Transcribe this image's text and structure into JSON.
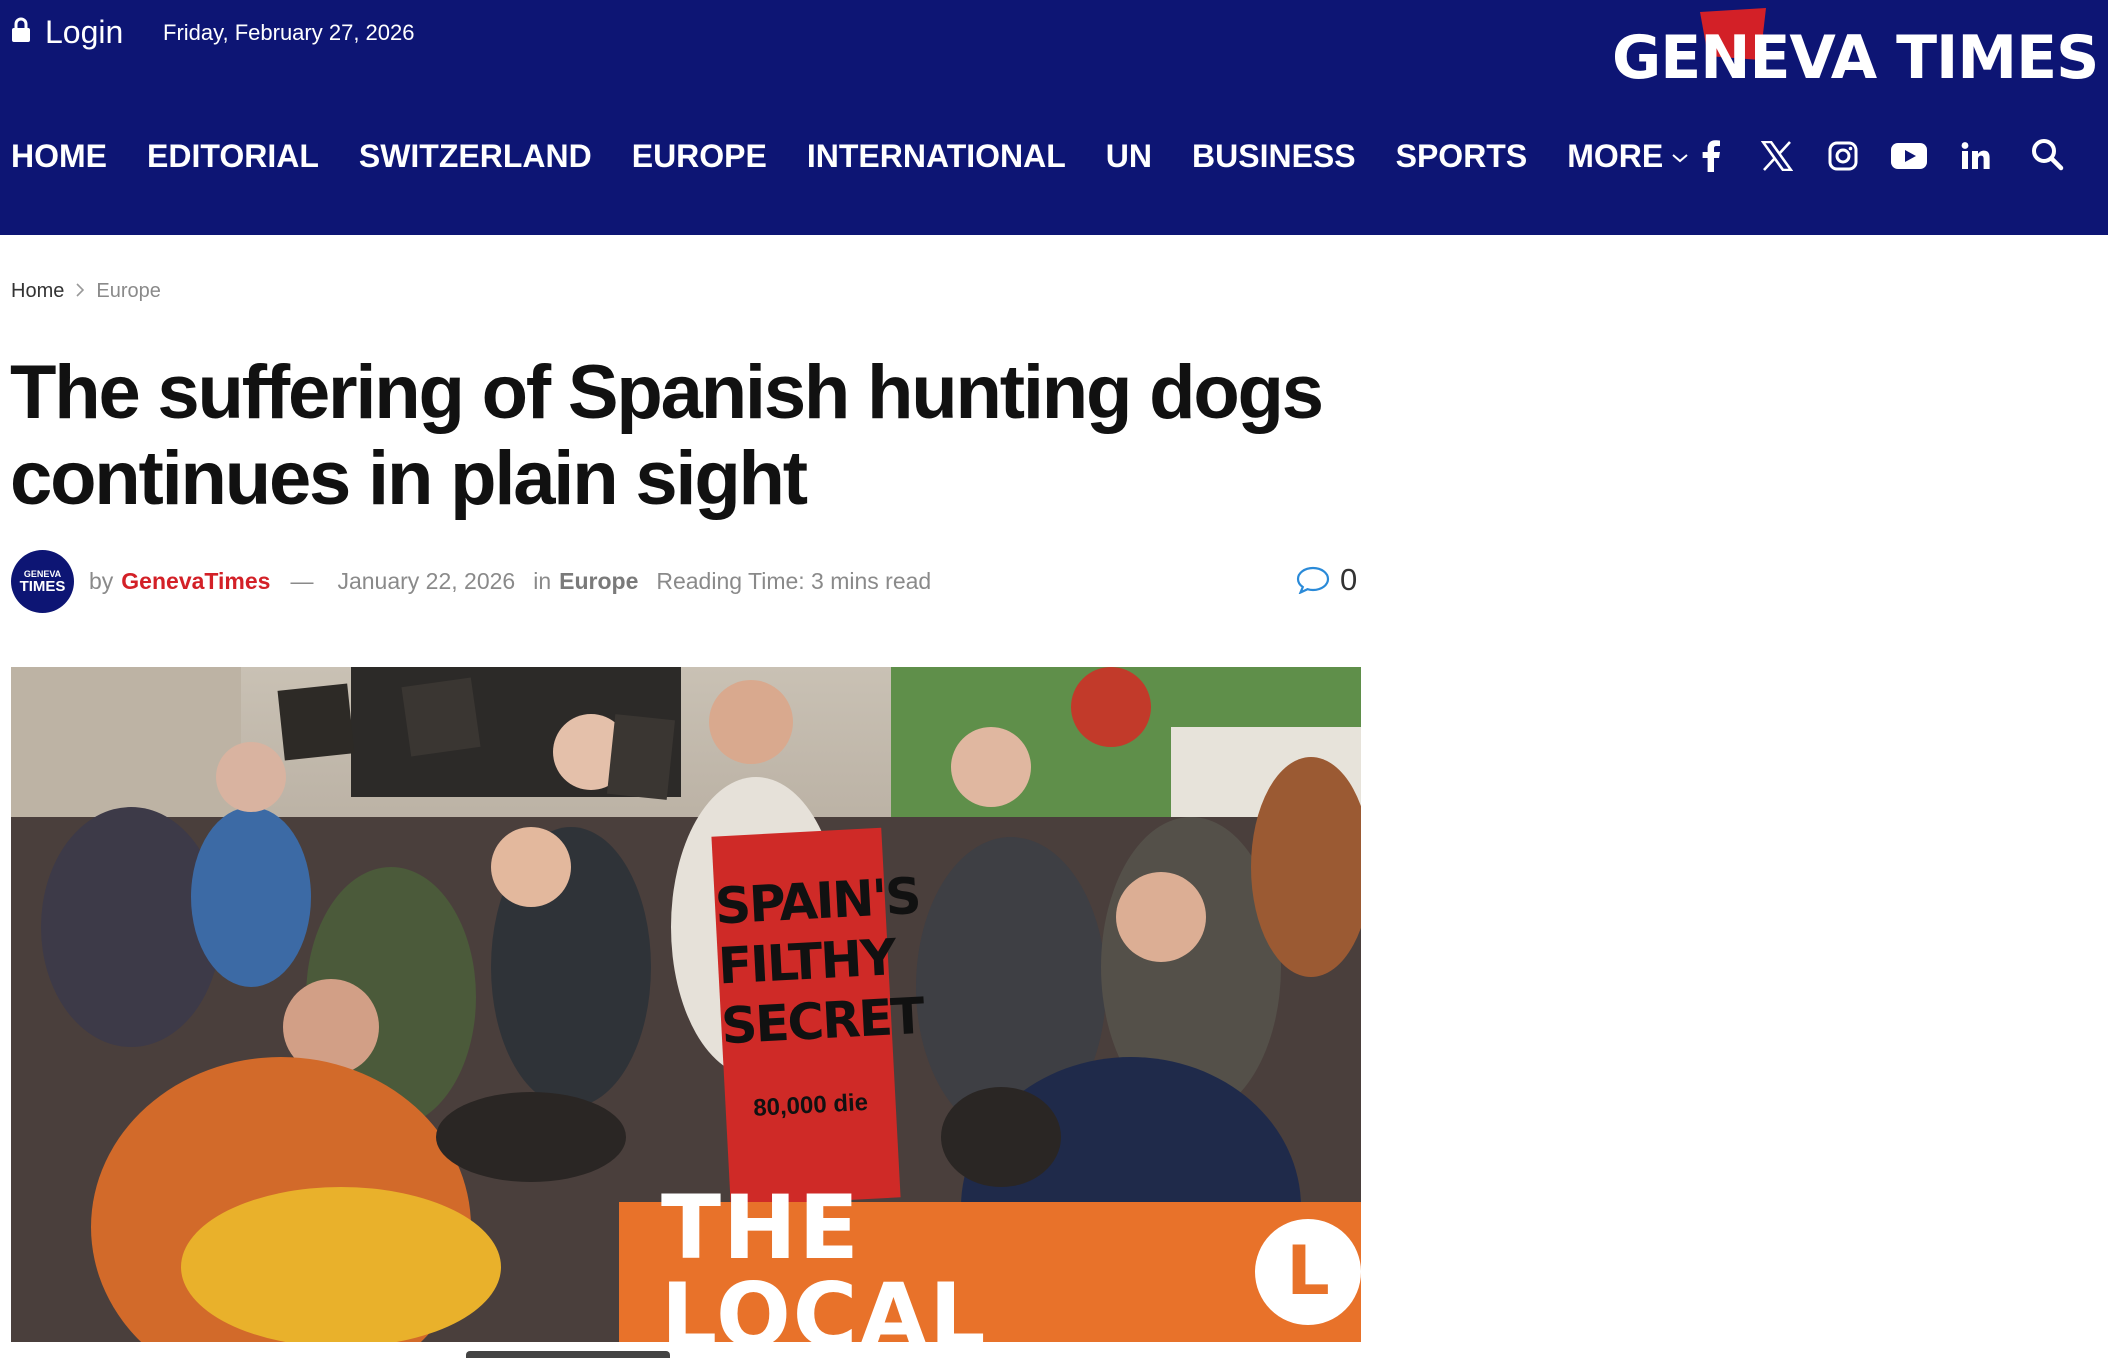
{
  "header": {
    "login_label": "Login",
    "date": "Friday, February 27, 2026",
    "brand": "GENEVA TIMES",
    "bg_color": "#0d1574",
    "accent_color": "#d32027"
  },
  "nav": {
    "items": [
      "HOME",
      "EDITORIAL",
      "SWITZERLAND",
      "EUROPE",
      "INTERNATIONAL",
      "UN",
      "BUSINESS",
      "SPORTS"
    ],
    "more_label": "MORE"
  },
  "social": [
    "facebook-icon",
    "x-icon",
    "instagram-icon",
    "youtube-icon",
    "linkedin-icon"
  ],
  "breadcrumb": {
    "home": "Home",
    "current": "Europe"
  },
  "article": {
    "title": "The suffering of Spanish hunting dogs continues in plain sight",
    "by": "by",
    "author": "GenevaTimes",
    "dash": "—",
    "date": "January 22, 2026",
    "in": "in",
    "category": "Europe",
    "reading_time": "Reading Time: 3 mins read",
    "comment_count": "0",
    "avatar_line1": "GENEVA",
    "avatar_line2": "TIMES"
  },
  "hero": {
    "watermark": "THE LOCAL",
    "watermark_logo": "L",
    "banner_text": "SPAIN'S FILTHY SECRET",
    "banner_sub": "80,000 die",
    "watermark_color": "#e8722a"
  }
}
